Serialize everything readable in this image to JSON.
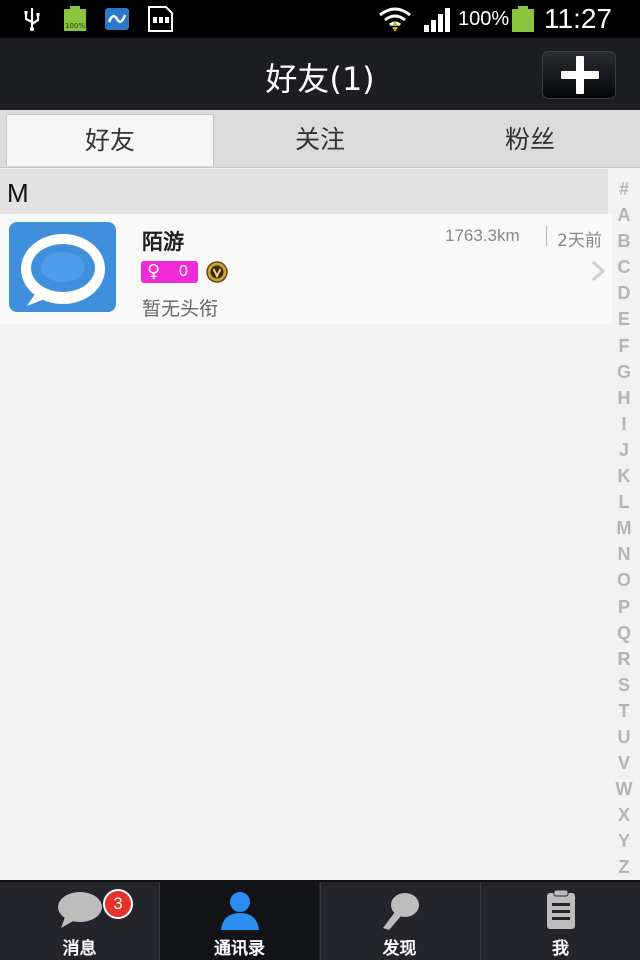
{
  "status_bar": {
    "battery_percent": "100%",
    "time": "11:27",
    "small_battery_label": "100%",
    "icons": [
      "usb-icon",
      "battery-full-icon",
      "app-notification-icon",
      "sd-card-icon",
      "wifi-icon",
      "signal-icon",
      "battery-icon"
    ]
  },
  "header": {
    "title": "好友(1)",
    "add_button_icon": "plus-icon"
  },
  "tabs": [
    {
      "label": "好友",
      "active": true
    },
    {
      "label": "关注",
      "active": false
    },
    {
      "label": "粉丝",
      "active": false
    }
  ],
  "section": {
    "letter": "M"
  },
  "friends": [
    {
      "name": "陌游",
      "distance": "1763.3km",
      "last_seen": "2天前",
      "gender_icon": "♀",
      "age": "0",
      "title": "暂无头衔",
      "avatar_icon": "chat-bubble-icon",
      "badge_icon": "vip-badge-icon"
    }
  ],
  "alphabet_index": [
    "#",
    "A",
    "B",
    "C",
    "D",
    "E",
    "F",
    "G",
    "H",
    "I",
    "J",
    "K",
    "L",
    "M",
    "N",
    "O",
    "P",
    "Q",
    "R",
    "S",
    "T",
    "U",
    "V",
    "W",
    "X",
    "Y",
    "Z"
  ],
  "bottom_nav": [
    {
      "label": "消息",
      "icon": "message-bubble-icon",
      "badge": "3",
      "active": false
    },
    {
      "label": "通讯录",
      "icon": "contacts-person-icon",
      "active": true
    },
    {
      "label": "发现",
      "icon": "discover-icon",
      "active": false
    },
    {
      "label": "我",
      "icon": "profile-clipboard-icon",
      "active": false
    }
  ],
  "colors": {
    "title_bar": "#1b1d21",
    "gender_badge": "#ee2ad9",
    "avatar_bg": "#3f8fdc",
    "unread_badge": "#e2332b",
    "nav_active_icon": "#2b8ef0"
  }
}
